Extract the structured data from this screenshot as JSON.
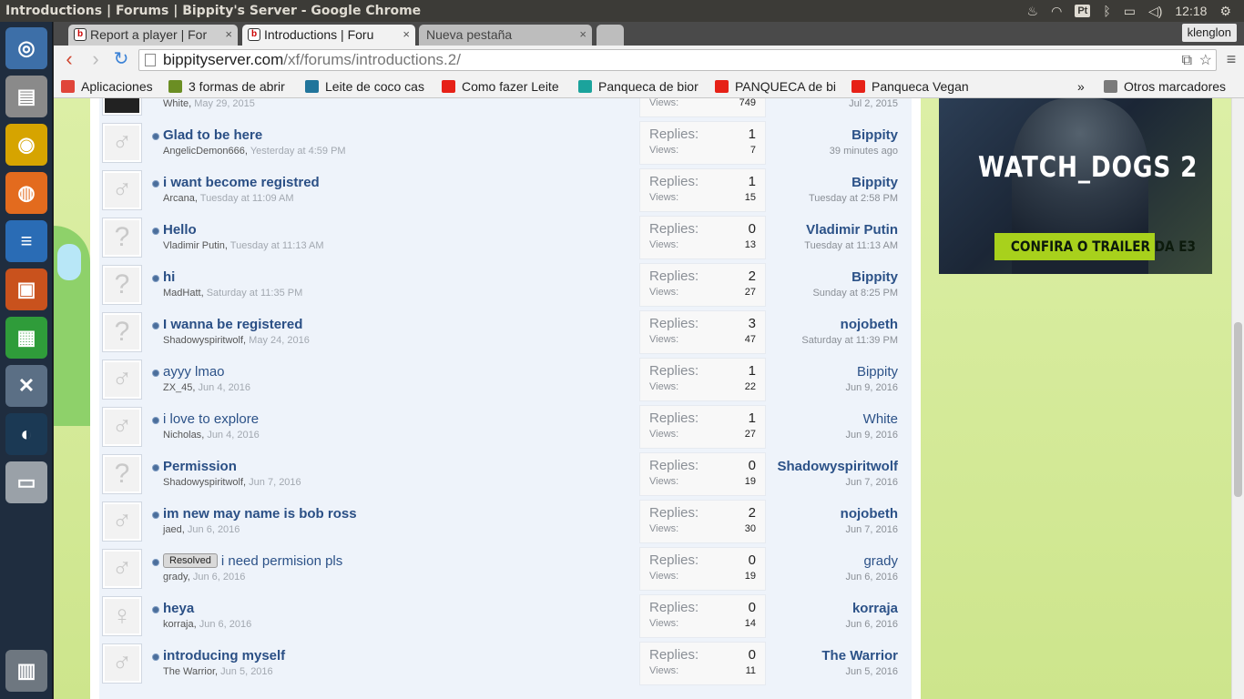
{
  "topbar": {
    "window_title": "Introductions | Forums | Bippity's Server - Google Chrome",
    "keyboard": "Pt",
    "time": "12:18"
  },
  "browser": {
    "tabs": [
      {
        "label": "Report a player | For",
        "close": "×"
      },
      {
        "label": "Introductions | Foru",
        "close": "×"
      },
      {
        "label": "Nueva pestaña",
        "close": "×"
      }
    ],
    "profile": "klenglon",
    "url_host": "bippityserver.com",
    "url_path": "/xf/forums/introductions.2/",
    "bookmarks": [
      {
        "label": "Aplicaciones",
        "icon": "apps-grid-icon",
        "color": "#e0453a"
      },
      {
        "label": "3 formas de abrir",
        "icon": "wikihow-icon",
        "color": "#6b8e23"
      },
      {
        "label": "Leite de coco cas",
        "icon": "wordpress-icon",
        "color": "#21759b"
      },
      {
        "label": "Como fazer Leite",
        "icon": "youtube-icon",
        "color": "#e62117"
      },
      {
        "label": "Panqueca de bior",
        "icon": "site-icon",
        "color": "#1ba39c"
      },
      {
        "label": "PANQUECA de bi",
        "icon": "youtube-icon",
        "color": "#e62117"
      },
      {
        "label": "Panqueca Vegan",
        "icon": "youtube-icon",
        "color": "#e62117"
      }
    ],
    "bookmarks_overflow": "»",
    "other_bookmarks": "Otros marcadores"
  },
  "labels": {
    "replies": "Replies:",
    "views": "Views:"
  },
  "threads": [
    {
      "title": "",
      "prefix": "",
      "unread": false,
      "author": "White",
      "date": "May 29, 2015",
      "replies": "",
      "views": "749",
      "last_user": "",
      "last_date": "Jul 2, 2015",
      "avatar": "dark"
    },
    {
      "title": "Glad to be here",
      "prefix": "",
      "unread": true,
      "author": "AngelicDemon666",
      "date": "Yesterday at 4:59 PM",
      "replies": "1",
      "views": "7",
      "last_user": "Bippity",
      "last_date": "39 minutes ago",
      "avatar": "male"
    },
    {
      "title": "i want become registred",
      "prefix": "",
      "unread": true,
      "author": "Arcana",
      "date": "Tuesday at 11:09 AM",
      "replies": "1",
      "views": "15",
      "last_user": "Bippity",
      "last_date": "Tuesday at 2:58 PM",
      "avatar": "male"
    },
    {
      "title": "Hello",
      "prefix": "",
      "unread": true,
      "author": "Vladimir Putin",
      "date": "Tuesday at 11:13 AM",
      "replies": "0",
      "views": "13",
      "last_user": "Vladimir Putin",
      "last_date": "Tuesday at 11:13 AM",
      "avatar": "unknown"
    },
    {
      "title": "hi",
      "prefix": "",
      "unread": true,
      "author": "MadHatt",
      "date": "Saturday at 11:35 PM",
      "replies": "2",
      "views": "27",
      "last_user": "Bippity",
      "last_date": "Sunday at 8:25 PM",
      "avatar": "unknown"
    },
    {
      "title": "I wanna be registered",
      "prefix": "",
      "unread": true,
      "author": "Shadowyspiritwolf",
      "date": "May 24, 2016",
      "replies": "3",
      "views": "47",
      "last_user": "nojobeth",
      "last_date": "Saturday at 11:39 PM",
      "avatar": "unknown"
    },
    {
      "title": "ayyy lmao",
      "prefix": "",
      "unread": false,
      "author": "ZX_45",
      "date": "Jun 4, 2016",
      "replies": "1",
      "views": "22",
      "last_user": "Bippity",
      "last_date": "Jun 9, 2016",
      "avatar": "male"
    },
    {
      "title": "i love to explore",
      "prefix": "",
      "unread": false,
      "author": "Nicholas",
      "date": "Jun 4, 2016",
      "replies": "1",
      "views": "27",
      "last_user": "White",
      "last_date": "Jun 9, 2016",
      "avatar": "male"
    },
    {
      "title": "Permission",
      "prefix": "",
      "unread": true,
      "author": "Shadowyspiritwolf",
      "date": "Jun 7, 2016",
      "replies": "0",
      "views": "19",
      "last_user": "Shadowyspiritwolf",
      "last_date": "Jun 7, 2016",
      "avatar": "unknown"
    },
    {
      "title": "im new may name is bob ross",
      "prefix": "",
      "unread": true,
      "author": "jaed",
      "date": "Jun 6, 2016",
      "replies": "2",
      "views": "30",
      "last_user": "nojobeth",
      "last_date": "Jun 7, 2016",
      "avatar": "male"
    },
    {
      "title": "i need permision pls",
      "prefix": "Resolved",
      "unread": false,
      "author": "grady",
      "date": "Jun 6, 2016",
      "replies": "0",
      "views": "19",
      "last_user": "grady",
      "last_date": "Jun 6, 2016",
      "avatar": "male"
    },
    {
      "title": "heya",
      "prefix": "",
      "unread": true,
      "author": "korraja",
      "date": "Jun 6, 2016",
      "replies": "0",
      "views": "14",
      "last_user": "korraja",
      "last_date": "Jun 6, 2016",
      "avatar": "female"
    },
    {
      "title": "introducing myself",
      "prefix": "",
      "unread": true,
      "author": "The Warrior",
      "date": "Jun 5, 2016",
      "replies": "0",
      "views": "11",
      "last_user": "The Warrior",
      "last_date": "Jun 5, 2016",
      "avatar": "male"
    }
  ],
  "ad": {
    "logo": "WATCH_DOGS 2",
    "cta": "CONFIRA O TRAILER DA E3"
  },
  "launcher": {
    "apps": [
      {
        "icon": "ubuntu-icon",
        "glyph": "◎",
        "color": "#3d6fa8"
      },
      {
        "icon": "files-icon",
        "glyph": "▤",
        "color": "#8a8a8a"
      },
      {
        "icon": "chrome-icon",
        "glyph": "◉",
        "color": "#d6a400"
      },
      {
        "icon": "firefox-icon",
        "glyph": "◍",
        "color": "#e36b1e"
      },
      {
        "icon": "writer-icon",
        "glyph": "≡",
        "color": "#2a6cb5"
      },
      {
        "icon": "impress-icon",
        "glyph": "▣",
        "color": "#c9521d"
      },
      {
        "icon": "calc-icon",
        "glyph": "▦",
        "color": "#2f9c3a"
      },
      {
        "icon": "system-settings-icon",
        "glyph": "✕",
        "color": "#5b6f85"
      },
      {
        "icon": "steam-icon",
        "glyph": "◐",
        "color": "#1b3954"
      },
      {
        "icon": "disk-icon",
        "glyph": "▭",
        "color": "#9aa1a8"
      },
      {
        "icon": "trash-icon",
        "glyph": "▥",
        "color": "#6e7780"
      }
    ]
  }
}
